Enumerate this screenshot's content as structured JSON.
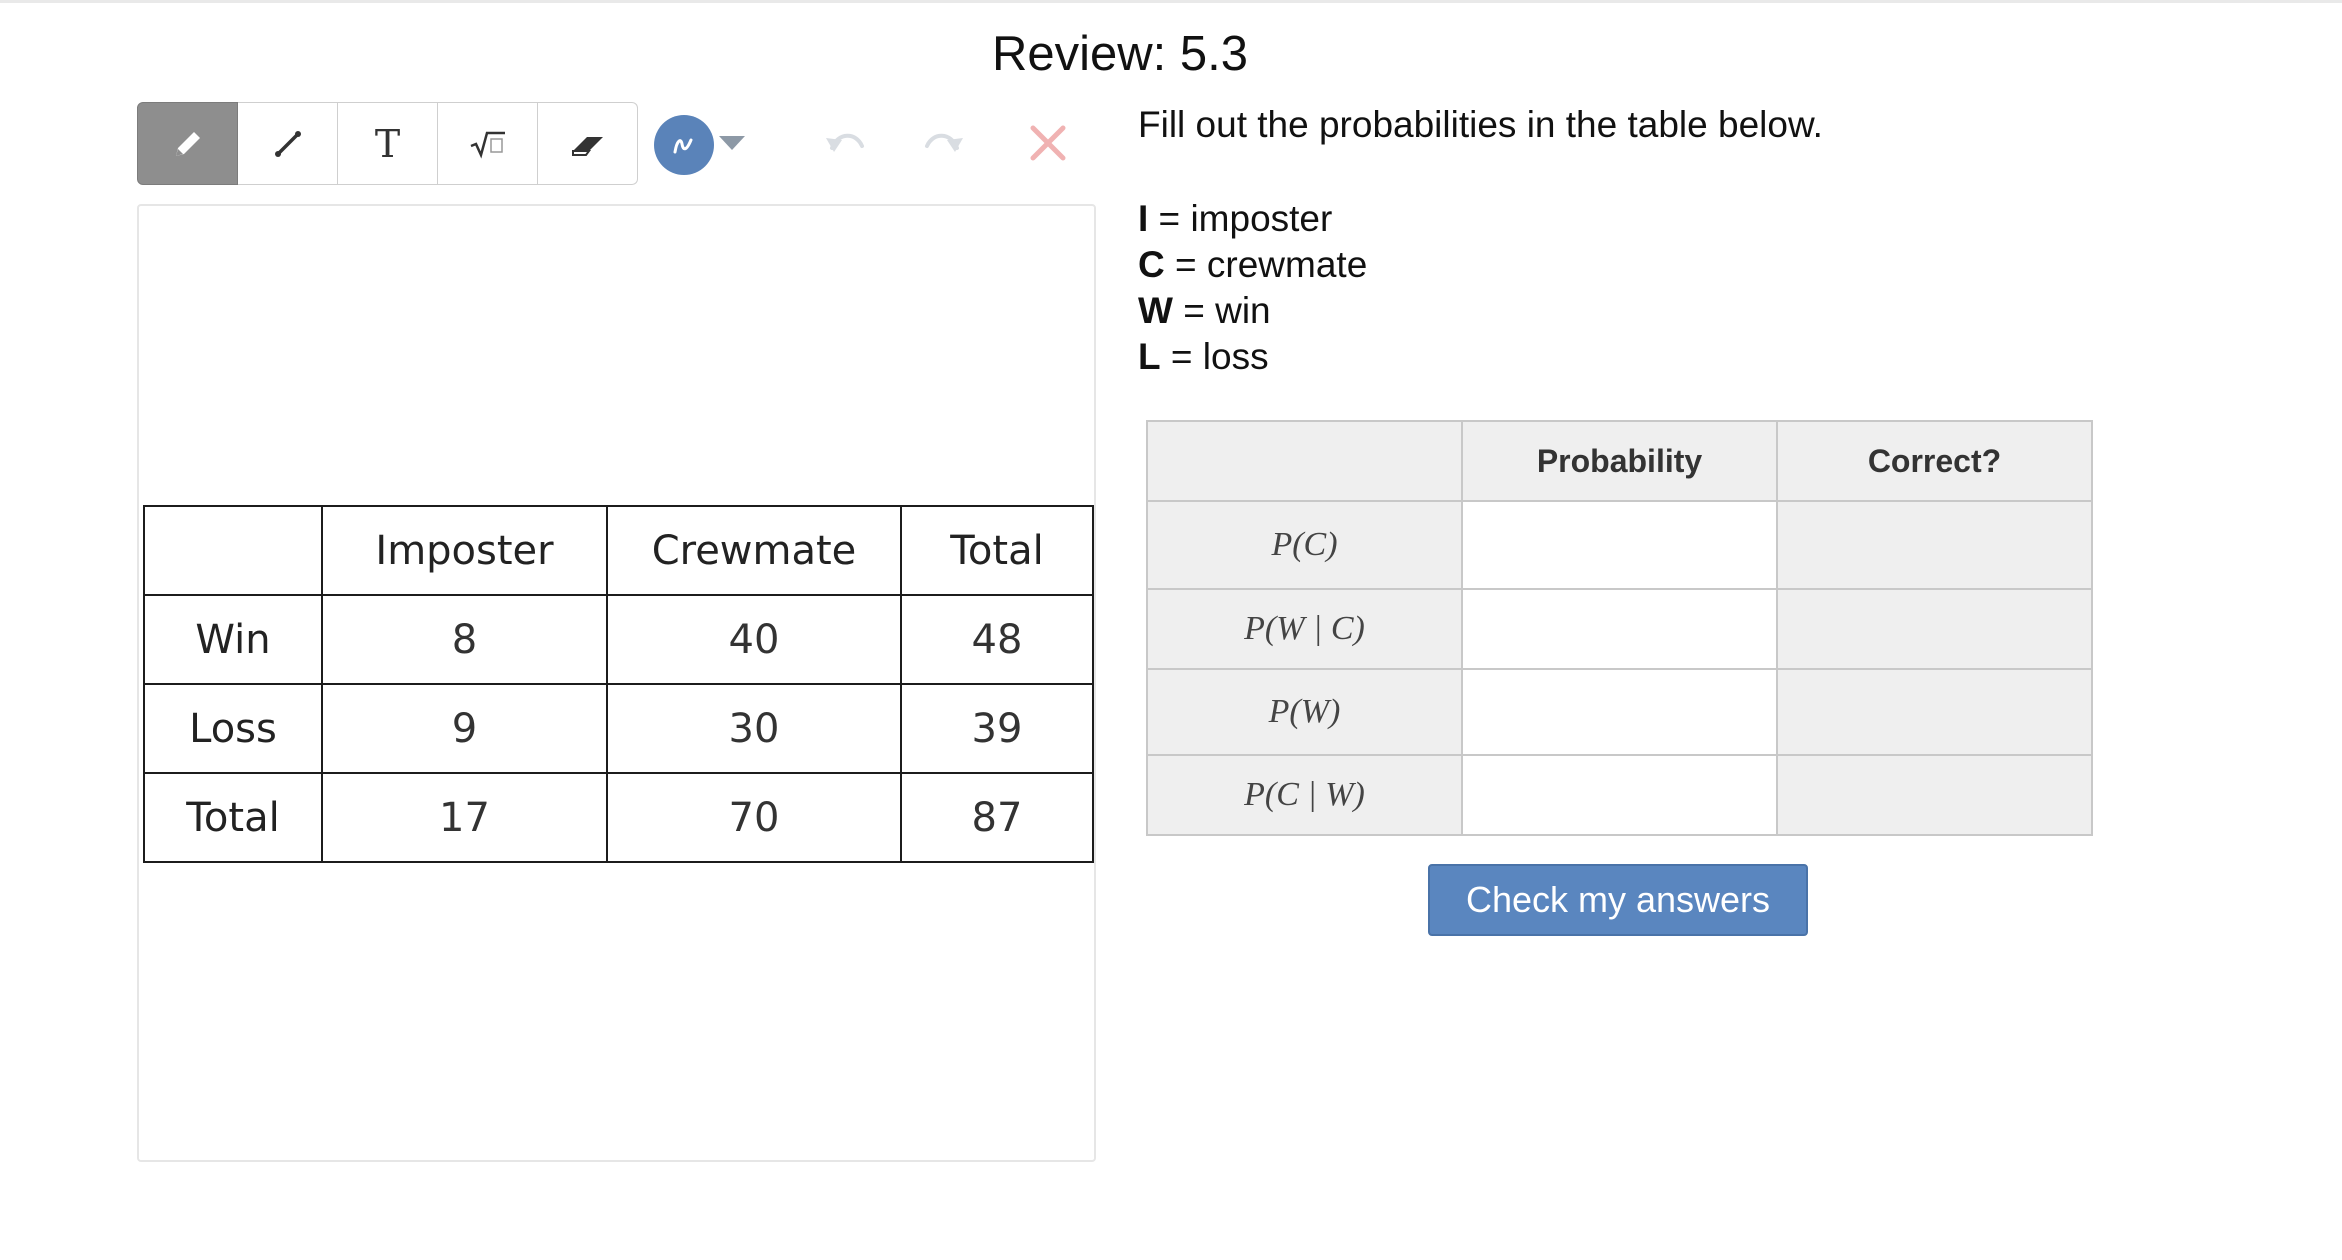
{
  "page": {
    "title": "Review: 5.3"
  },
  "toolbar": {
    "tools": [
      {
        "name": "pencil",
        "icon": "pencil-icon",
        "active": true
      },
      {
        "name": "line",
        "icon": "line-icon"
      },
      {
        "name": "text",
        "icon": "text-icon",
        "glyph": "T"
      },
      {
        "name": "math",
        "icon": "square-root-icon"
      },
      {
        "name": "eraser",
        "icon": "eraser-icon"
      }
    ],
    "color": "#5a83b9",
    "undo_icon": "undo-icon",
    "redo_icon": "redo-icon",
    "clear_icon": "close-icon"
  },
  "data_table": {
    "columns": [
      "",
      "Imposter",
      "Crewmate",
      "Total"
    ],
    "rows": [
      {
        "label": "Win",
        "values": [
          "8",
          "40",
          "48"
        ]
      },
      {
        "label": "Loss",
        "values": [
          "9",
          "30",
          "39"
        ]
      },
      {
        "label": "Total",
        "values": [
          "17",
          "70",
          "87"
        ]
      }
    ]
  },
  "instruction": "Fill out the probabilities in the table below.",
  "legend": [
    {
      "key": "I",
      "text": " = imposter"
    },
    {
      "key": "C",
      "text": " = crewmate"
    },
    {
      "key": "W",
      "text": " = win"
    },
    {
      "key": "L",
      "text": " = loss"
    }
  ],
  "answer_table": {
    "headers": [
      "",
      "Probability",
      "Correct?"
    ],
    "rows": [
      {
        "label": "P(C)",
        "value": ""
      },
      {
        "label": "P(W | C)",
        "value": ""
      },
      {
        "label": "P(W)",
        "value": ""
      },
      {
        "label": "P(C | W)",
        "value": ""
      }
    ]
  },
  "check_button": {
    "label": "Check my answers"
  },
  "colors": {
    "accent": "#5a86bf",
    "clear": "#f0b2b2"
  }
}
